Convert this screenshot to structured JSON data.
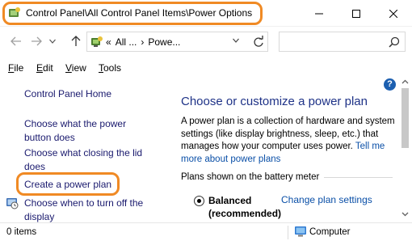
{
  "window": {
    "title": "Control Panel\\All Control Panel Items\\Power Options",
    "controls": {
      "minimize": "minimize-icon",
      "maximize": "maximize-icon",
      "close": "close-icon"
    }
  },
  "address": {
    "prefix": "«",
    "crumbs": [
      "All ...",
      "›",
      "Powe..."
    ],
    "search_placeholder": ""
  },
  "menu": [
    {
      "label": "File",
      "key": "F",
      "rest": "ile"
    },
    {
      "label": "Edit",
      "key": "E",
      "rest": "dit"
    },
    {
      "label": "View",
      "key": "V",
      "rest": "iew"
    },
    {
      "label": "Tools",
      "key": "T",
      "rest": "ools"
    }
  ],
  "sidebar": {
    "home": "Control Panel Home",
    "links": [
      "Choose what the power button does",
      "Choose what closing the lid does",
      "Create a power plan",
      "Choose when to turn off the display"
    ]
  },
  "main": {
    "title": "Choose or customize a power plan",
    "desc_text": "A power plan is a collection of hardware and system settings (like display brightness, sleep, etc.) that manages how your computer uses power.",
    "desc_link": "Tell me more about power plans",
    "section": "Plans shown on the battery meter",
    "plan_name": "Balanced (recommended)",
    "plan_selected": true,
    "change_link": "Change plan settings"
  },
  "status": {
    "items": "0 items",
    "location": "Computer"
  },
  "colors": {
    "highlight": "#f08a24",
    "title_blue": "#1e3287",
    "link_blue": "#0a4fa7"
  }
}
